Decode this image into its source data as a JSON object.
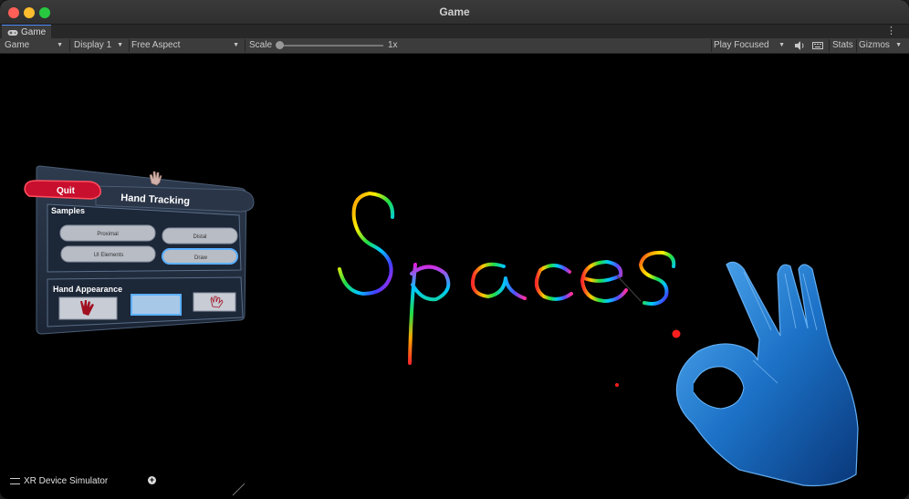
{
  "window": {
    "title": "Game"
  },
  "tabs": [
    {
      "label": "Game",
      "icon": "gamepad-icon"
    }
  ],
  "toolbar": {
    "mode": "Game",
    "display": "Display 1",
    "aspect": "Free Aspect",
    "scale_label": "Scale",
    "scale_value": "1x",
    "play_mode": "Play Focused",
    "stats": "Stats",
    "gizmos": "Gizmos"
  },
  "panel": {
    "quit": "Quit",
    "title": "Hand Tracking",
    "samples_heading": "Samples",
    "sample_buttons": [
      "Proximal",
      "Distal",
      "UI Elements",
      "Draw"
    ],
    "appearance_heading": "Hand Appearance"
  },
  "drawing": {
    "word": "Spaces"
  },
  "simulator": {
    "label": "XR Device Simulator"
  },
  "colors": {
    "hand": "#1e78d2",
    "dot": "#ff1e1e",
    "quit": "#c8102e"
  }
}
